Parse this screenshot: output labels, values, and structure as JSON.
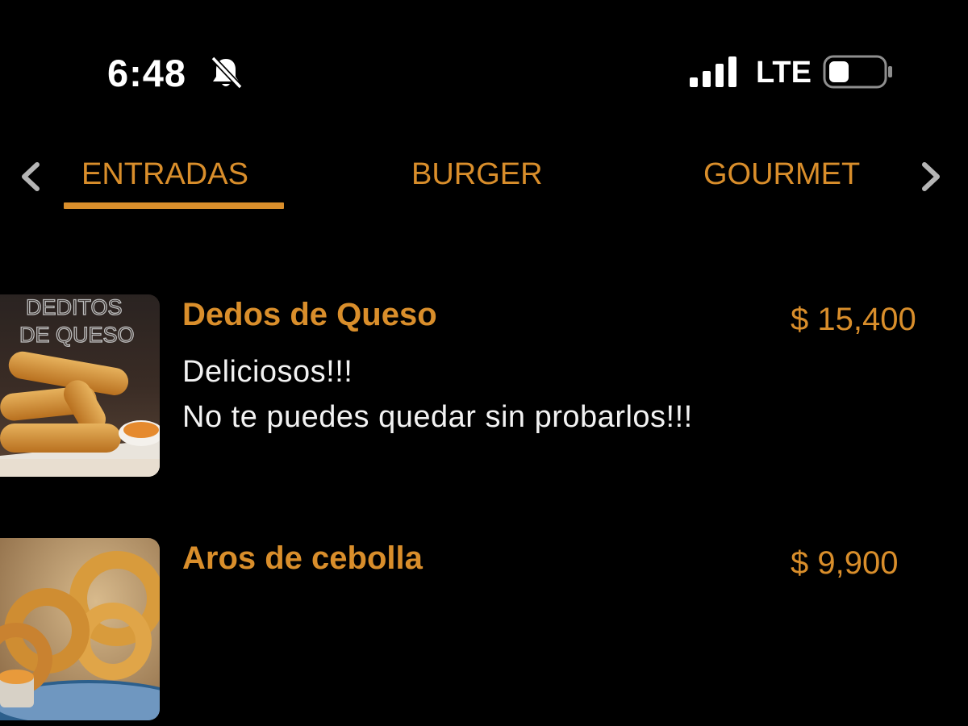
{
  "status_bar": {
    "time": "6:48",
    "network": "LTE",
    "icons": [
      "bell-slash-icon",
      "signal-icon",
      "battery-icon"
    ]
  },
  "tabs": [
    {
      "label": "ENTRADAS",
      "selected": true
    },
    {
      "label": "BURGER",
      "selected": false
    },
    {
      "label": "GOURMET",
      "selected": false
    }
  ],
  "colors": {
    "accent": "#d98e2b",
    "background": "#000000",
    "text": "#f2f2f2"
  },
  "items": [
    {
      "name": "Dedos de Queso",
      "price": "$ 15,400",
      "description": "Deliciosos!!!\nNo te puedes quedar sin probarlos!!!",
      "image_text": "DEDITOS DE QUESO"
    },
    {
      "name": "Aros de cebolla",
      "price": "$ 9,900",
      "description": ""
    }
  ]
}
